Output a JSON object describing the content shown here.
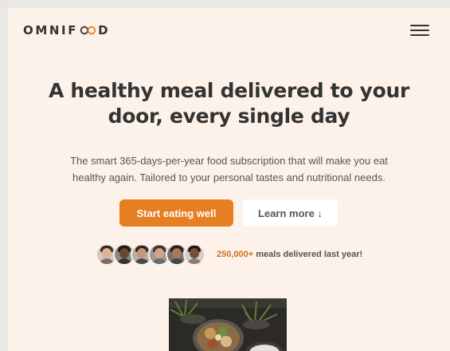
{
  "header": {
    "logo_prefix": "OMNIF",
    "logo_suffix": "D",
    "logo_full": "OMNIFOOD",
    "menu_icon": "hamburger-menu-icon"
  },
  "hero": {
    "title_line1": "A healthy meal delivered to your",
    "title_line2": "door, every single day",
    "description_line1": "The smart 365-days-per-year food subscription that will make you eat",
    "description_line2": "healthy again. Tailored to your personal tastes and nutritional needs.",
    "primary_button": "Start eating well",
    "secondary_button": "Learn more ↓",
    "delivered_highlight": "250,000+",
    "delivered_text": " meals delivered last year!",
    "image_icon": "meal-bowls-image"
  },
  "colors": {
    "background": "#fdf2e9",
    "accent": "#e67e22",
    "accent_dark": "#cf711f",
    "text": "#333333"
  }
}
